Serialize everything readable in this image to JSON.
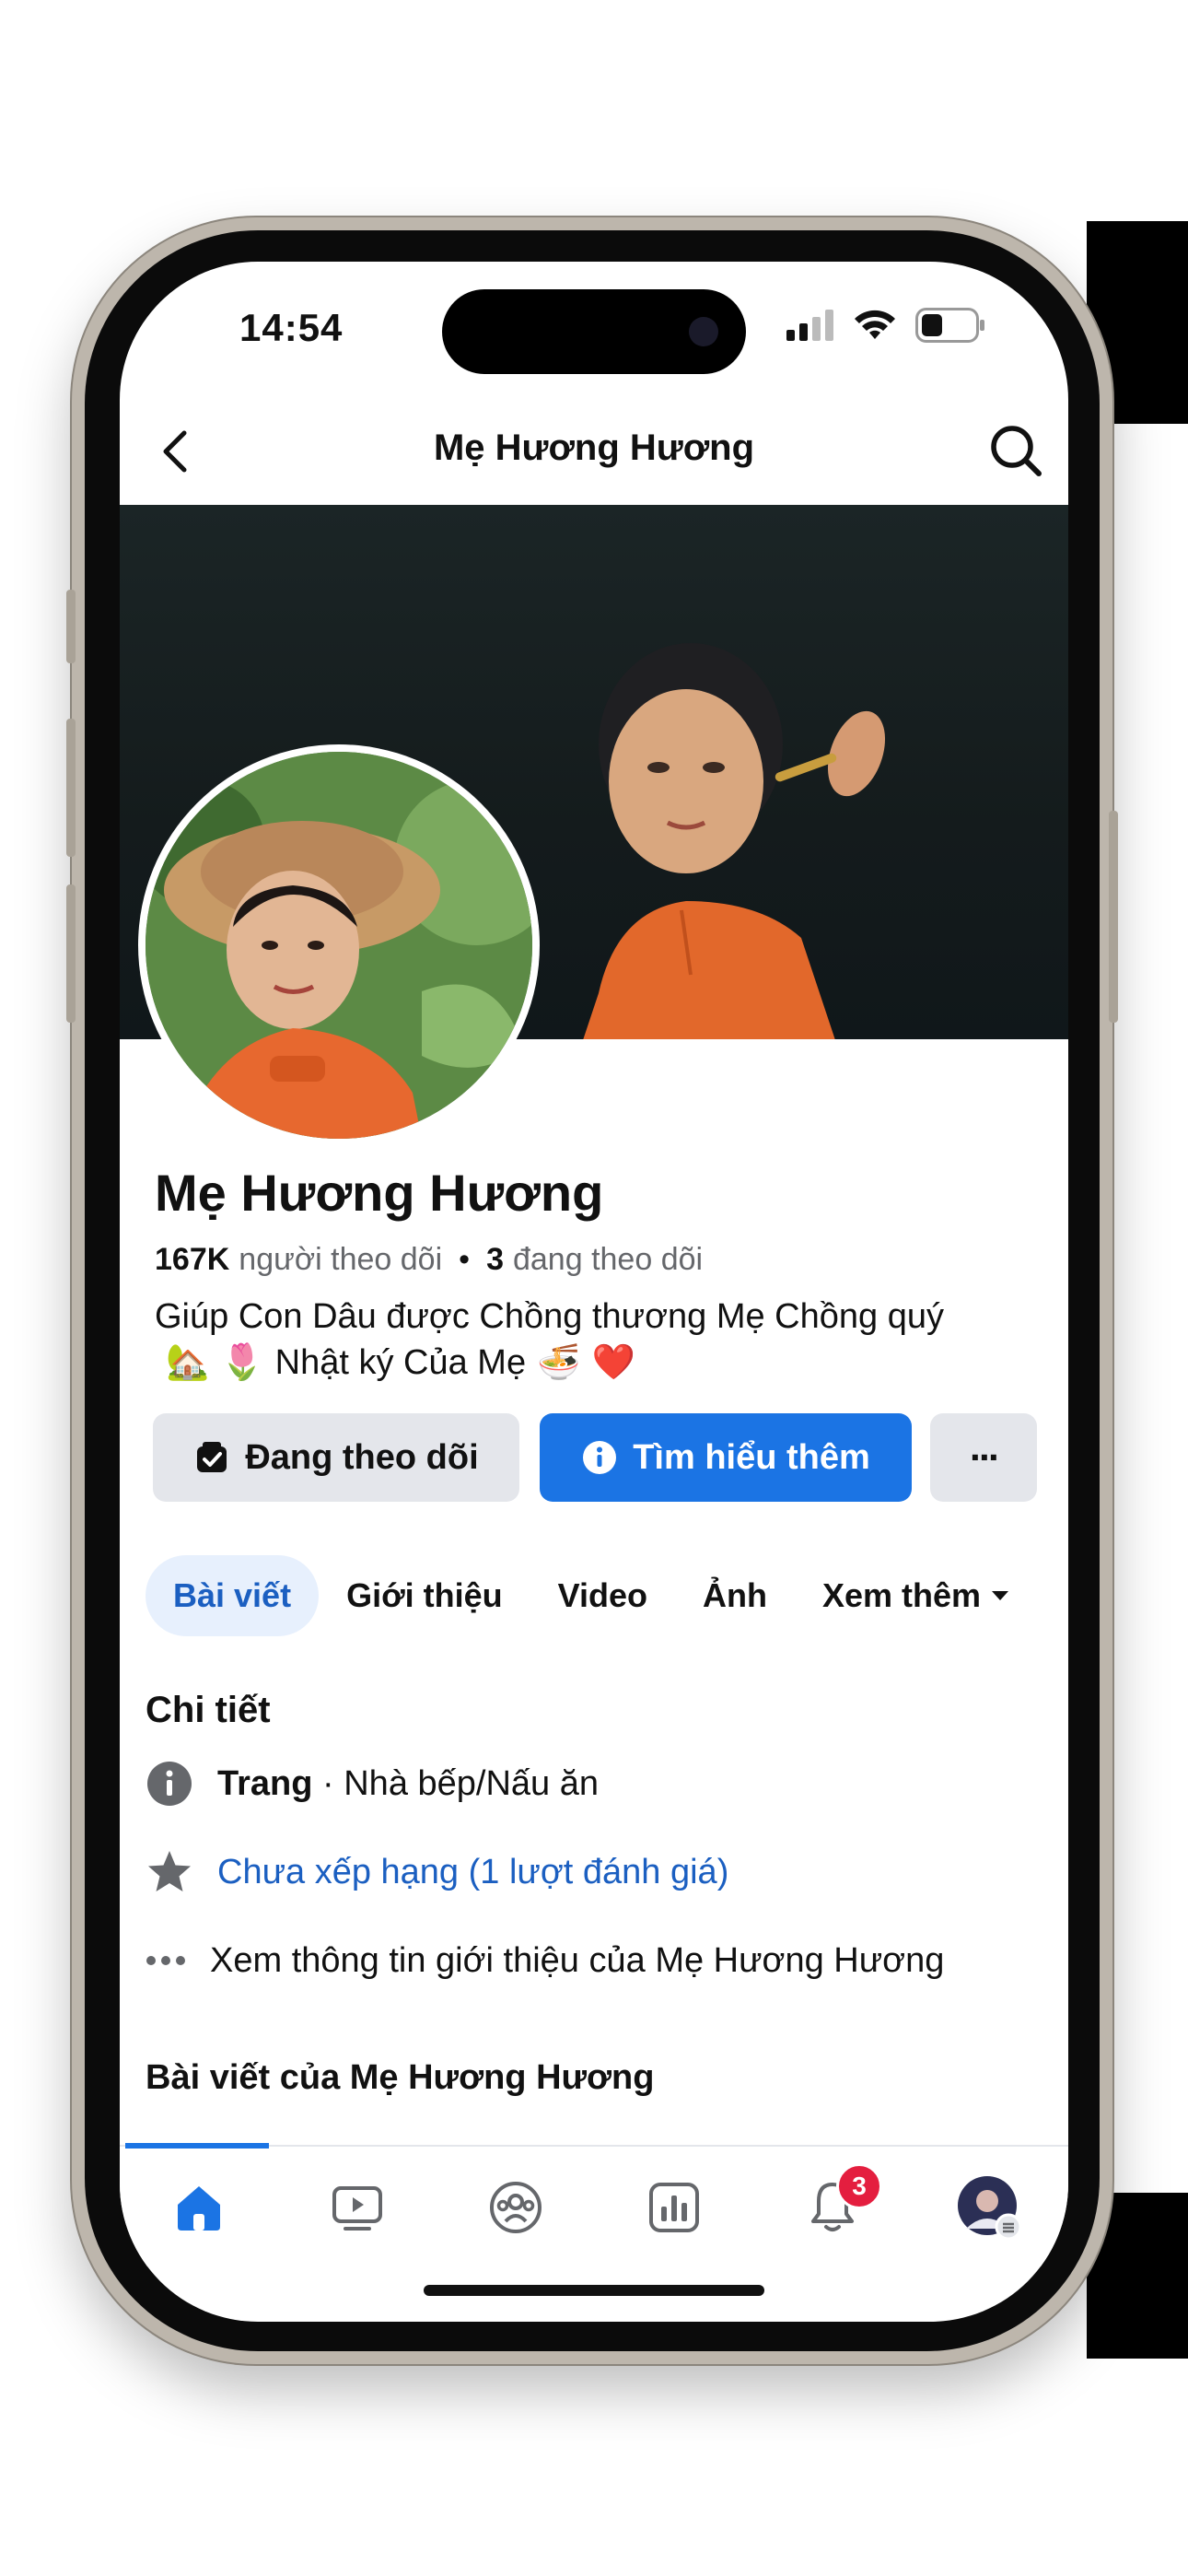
{
  "status": {
    "time": "14:54"
  },
  "navbar": {
    "title": "Mẹ Hương Hương"
  },
  "profile": {
    "name": "Mẹ Hương Hương",
    "followers_count": "167K",
    "followers_label": "người theo dõi",
    "separator": "•",
    "following_count": "3",
    "following_label": "đang theo dõi",
    "bio_line1": "Giúp Con Dâu được Chồng thương Mẹ Chồng quý",
    "bio_line2_text": "Nhật ký Của Mẹ",
    "bio_emojis": [
      "🏡",
      "🌷",
      "🍜",
      "❤️"
    ]
  },
  "actions": {
    "following_label": "Đang theo dõi",
    "learn_more_label": "Tìm hiểu thêm",
    "more_label": "···"
  },
  "tabs": [
    "Bài viết",
    "Giới thiệu",
    "Video",
    "Ảnh",
    "Xem thêm"
  ],
  "details": {
    "title": "Chi tiết",
    "type_label": "Trang",
    "type_value": "· Nhà bếp/Nấu ăn",
    "rating": "Chưa xếp hạng (1 lượt đánh giá)",
    "see_about": "Xem thông tin giới thiệu của Mẹ Hương Hương"
  },
  "posts": {
    "title": "Bài viết của Mẹ Hương Hương"
  },
  "tabbar": {
    "items": [
      "home-icon",
      "video-icon",
      "groups-icon",
      "dashboard-icon",
      "notifications-icon",
      "profile-avatar"
    ],
    "notifications_badge": "3"
  },
  "colors": {
    "accent": "#1b74e4",
    "link": "#1b5fc1",
    "badge": "#e41e3f"
  }
}
